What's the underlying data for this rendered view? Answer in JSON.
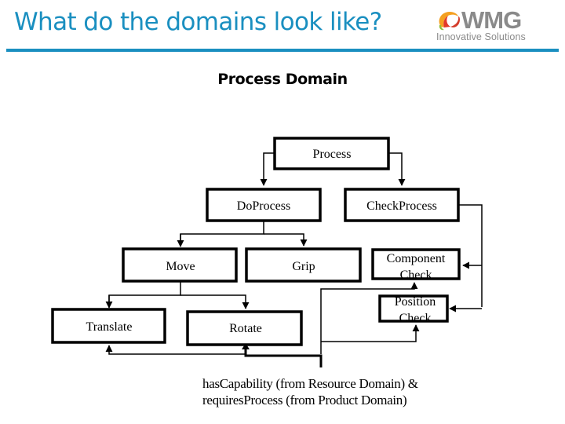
{
  "header": {
    "title": "What do the domains look like?",
    "logo": {
      "name": "WMG",
      "tagline": "Innovative Solutions"
    },
    "accent_color": "#1a8fc0"
  },
  "subtitle": "Process Domain",
  "diagram": {
    "nodes": [
      {
        "id": "process",
        "label": "Process"
      },
      {
        "id": "doprocess",
        "label": "DoProcess"
      },
      {
        "id": "checkprocess",
        "label": "CheckProcess"
      },
      {
        "id": "move",
        "label": "Move"
      },
      {
        "id": "grip",
        "label": "Grip"
      },
      {
        "id": "component-check",
        "label_line1": "Component",
        "label_line2": "Check"
      },
      {
        "id": "position-check",
        "label_line1": "Position",
        "label_line2": "Check"
      },
      {
        "id": "translate",
        "label": "Translate"
      },
      {
        "id": "rotate",
        "label": "Rotate"
      }
    ],
    "edges": [
      {
        "from": "process",
        "to": "doprocess"
      },
      {
        "from": "process",
        "to": "checkprocess"
      },
      {
        "from": "doprocess",
        "to": "move"
      },
      {
        "from": "doprocess",
        "to": "grip"
      },
      {
        "from": "checkprocess",
        "to": "component-check"
      },
      {
        "from": "checkprocess",
        "to": "position-check"
      },
      {
        "from": "move",
        "to": "translate"
      },
      {
        "from": "move",
        "to": "rotate"
      },
      {
        "from": "external",
        "to": "translate"
      },
      {
        "from": "external",
        "to": "rotate"
      },
      {
        "from": "external",
        "to": "component-check"
      },
      {
        "from": "external",
        "to": "position-check"
      }
    ],
    "caption_line1": "hasCapability (from Resource Domain) &",
    "caption_line2": "requiresProcess (from Product Domain)"
  }
}
